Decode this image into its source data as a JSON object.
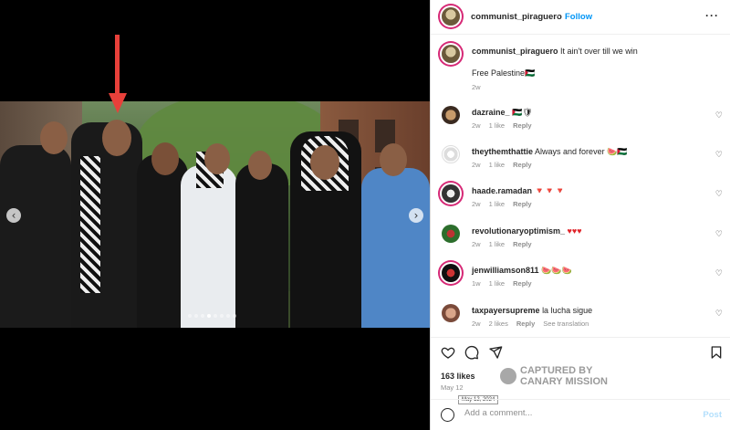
{
  "post": {
    "username": "communist_piraguero",
    "follow_label": "Follow",
    "separator": "•",
    "caption_line1": "It ain't over till we win",
    "caption_line2": "Free Palestine🇵🇸",
    "caption_age": "2w"
  },
  "comments": [
    {
      "user": "dazraine_",
      "text": "🇵🇸🛡",
      "age": "2w",
      "likes": "1 like",
      "reply": "Reply",
      "extra": ""
    },
    {
      "user": "theythemthattie",
      "text": "Always and forever 🍉🇵🇸",
      "age": "2w",
      "likes": "1 like",
      "reply": "Reply",
      "extra": ""
    },
    {
      "user": "haade.ramadan",
      "text": "🔻🔻🔻",
      "age": "2w",
      "likes": "1 like",
      "reply": "Reply",
      "extra": ""
    },
    {
      "user": "revolutionaryoptimism_",
      "text": "♥♥♥",
      "age": "2w",
      "likes": "1 like",
      "reply": "Reply",
      "extra": ""
    },
    {
      "user": "jenwilliamson811",
      "text": "🍉🍉🍉",
      "age": "1w",
      "likes": "1 like",
      "reply": "Reply",
      "extra": ""
    },
    {
      "user": "taxpayersupreme",
      "text": "la lucha sigue",
      "age": "2w",
      "likes": "2 likes",
      "reply": "Reply",
      "extra": "See translation"
    }
  ],
  "footer": {
    "likes": "163 likes",
    "date": "May 12",
    "tooltip": "May 12, 2024",
    "add_comment_placeholder": "Add a comment...",
    "post_label": "Post"
  },
  "watermark": {
    "line1": "CAPTURED BY",
    "line2": "CANARY MISSION"
  },
  "icons": {
    "more": "more-options-icon",
    "heart": "heart-icon",
    "comment": "comment-icon",
    "share": "share-icon",
    "bookmark": "bookmark-icon",
    "emoji": "emoji-icon",
    "prev": "chevron-left-icon",
    "next": "chevron-right-icon"
  },
  "colors": {
    "link_blue": "#0095f6",
    "arrow_red": "#e8403a"
  }
}
